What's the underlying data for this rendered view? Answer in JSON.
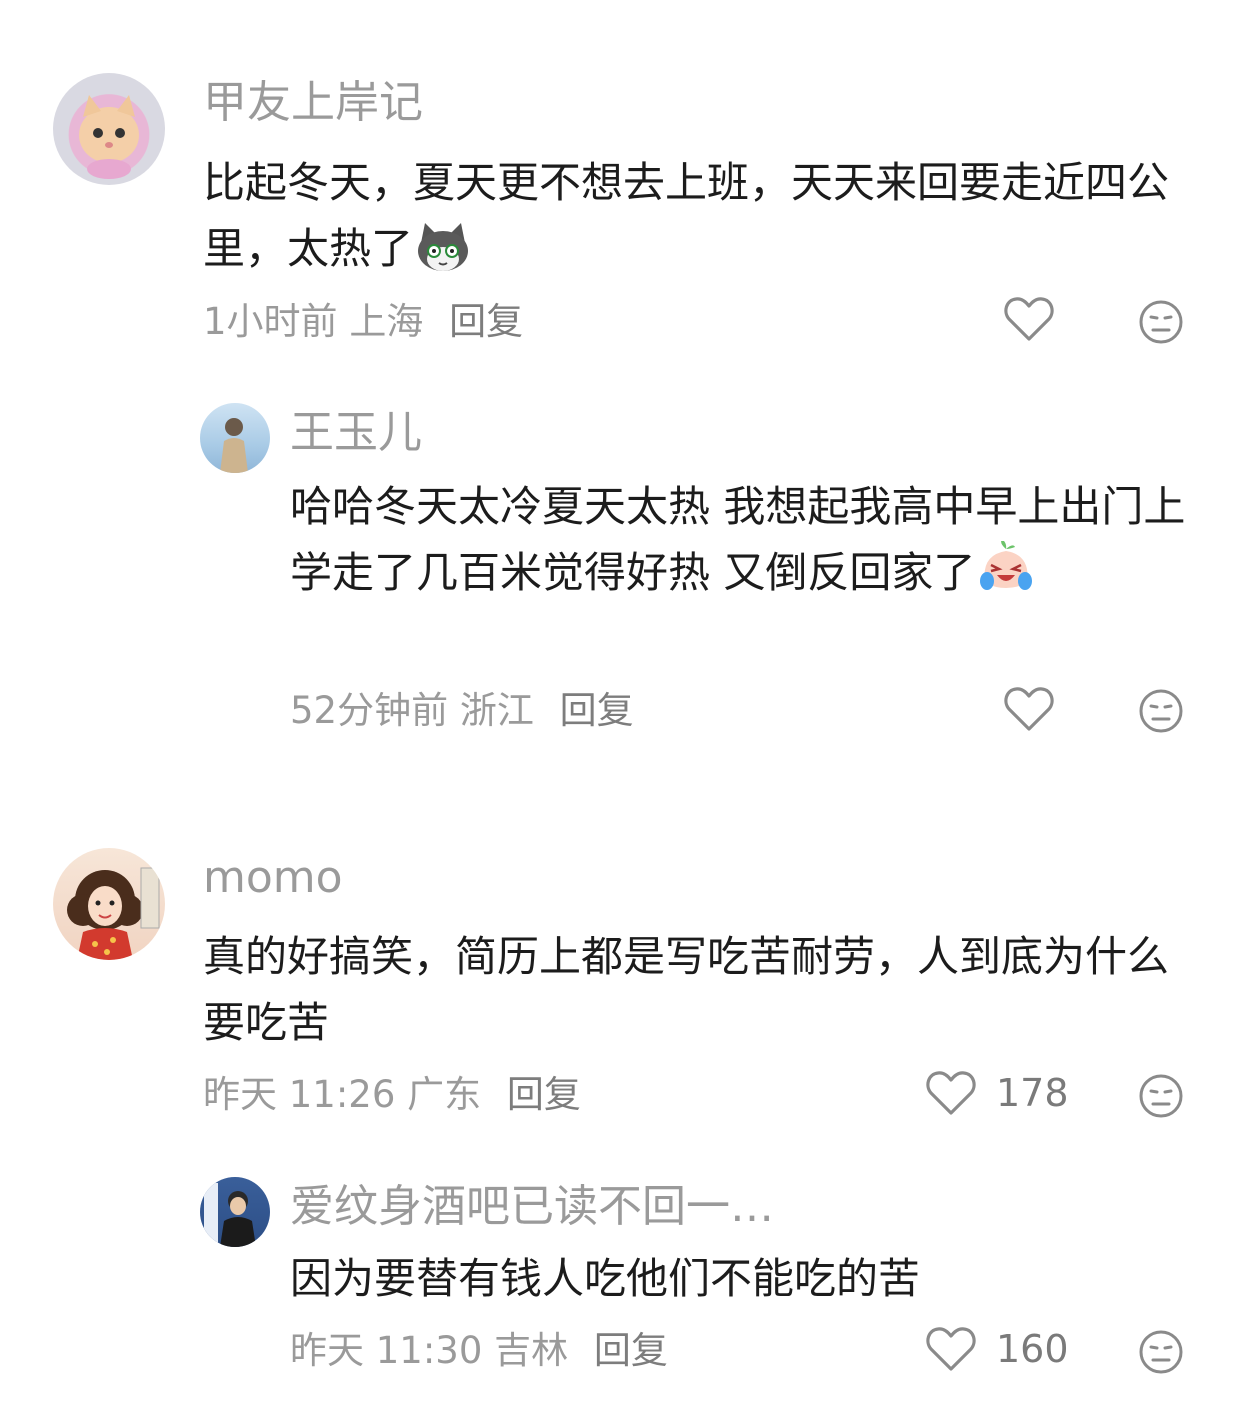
{
  "comments": [
    {
      "username": "甲友上岸记",
      "text": "比起冬天，夏天更不想去上班，天天来回要走近四公里，太热了",
      "emoji": "cat-face-emoji",
      "time": "1小时前",
      "location": "上海",
      "reply_label": "回复",
      "likes": "",
      "reply": {
        "username": "王玉儿",
        "text": "哈哈冬天太冷夏天太热 我想起我高中早上出门上学走了几百米觉得好热 又倒反回家了",
        "emoji": "laugh-cry-emoji",
        "time": "52分钟前",
        "location": "浙江",
        "reply_label": "回复",
        "likes": ""
      }
    },
    {
      "username": "momo",
      "text": "真的好搞笑，简历上都是写吃苦耐劳，人到底为什么要吃苦",
      "time": "昨天 11:26",
      "location": "广东",
      "reply_label": "回复",
      "likes": "178",
      "reply": {
        "username": "爱纹身酒吧已读不回一…",
        "text": "因为要替有钱人吃他们不能吃的苦",
        "time": "昨天 11:30",
        "location": "吉林",
        "reply_label": "回复",
        "likes": "160"
      }
    }
  ],
  "icons": {
    "like": "heart-outline-icon",
    "dislike": "unamused-face-icon"
  },
  "colors": {
    "username": "#9a9a9a",
    "text": "#1c1c1c",
    "meta": "#9a9a9a"
  }
}
